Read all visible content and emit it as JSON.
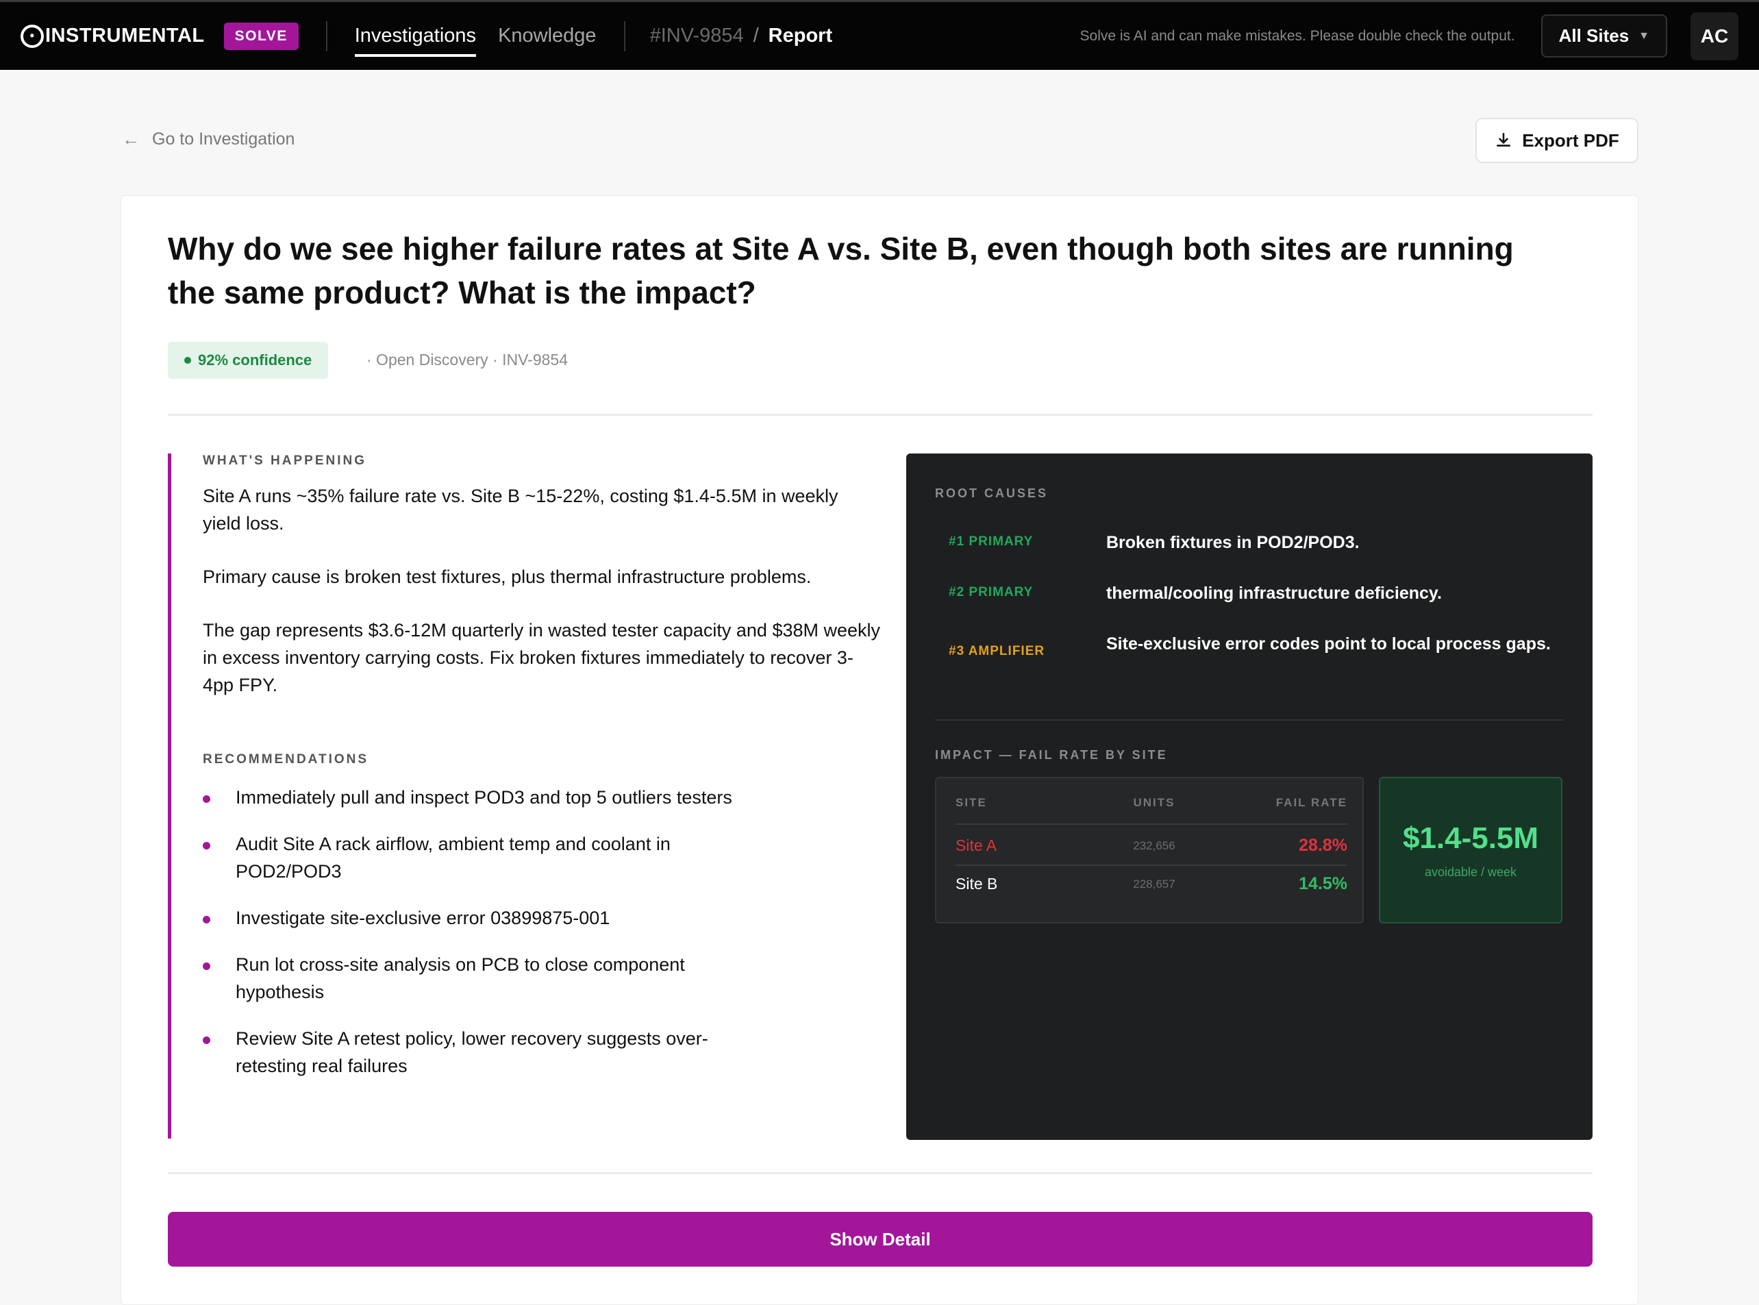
{
  "nav": {
    "logo_text": "INSTRUMENTAL",
    "logo_mark": "IN",
    "badge": "SOLVE",
    "links": [
      {
        "label": "Investigations",
        "active": true
      },
      {
        "label": "Knowledge",
        "active": false
      }
    ],
    "breadcrumb": {
      "id": "#INV-9854",
      "separator": "/",
      "page": "Report"
    },
    "disclaimer": "Solve is AI and can make mistakes. Please double check the output.",
    "site_select": {
      "value": "All Sites",
      "icon": "chevron-down-icon"
    },
    "avatar": "AC"
  },
  "subheader": {
    "back_label": "Go to Investigation",
    "back_icon": "arrow-left-icon",
    "export_label": "Export PDF",
    "export_icon": "download-icon"
  },
  "report": {
    "question": "Why do we see higher failure rates at Site A vs. Site B, even though both sites are running the same product? What is the impact?",
    "confidence": "92% confidence",
    "meta": "· Open Discovery · INV-9854",
    "whats_happening": {
      "label": "WHAT'S HAPPENING",
      "paragraphs": [
        "Site A runs ~35% failure rate vs. Site B ~15-22%, costing $1.4-5.5M in weekly yield loss.",
        "Primary cause is broken test fixtures, plus thermal infrastructure problems.",
        "The gap represents $3.6-12M quarterly in wasted tester capacity and $38M weekly in excess inventory carrying costs. Fix broken fixtures immediately to recover 3-4pp FPY."
      ]
    },
    "recommendations": {
      "label": "RECOMMENDATIONS",
      "items": [
        "Immediately pull and inspect POD3 and top 5 outliers testers",
        "Audit Site A rack airflow, ambient temp and coolant in POD2/POD3",
        "Investigate site-exclusive error 03899875-001",
        "Run lot cross-site analysis on PCB to close component hypothesis",
        "Review Site A retest policy, lower recovery suggests over-retesting real failures"
      ]
    },
    "root_causes": {
      "label": "ROOT CAUSES",
      "items": [
        {
          "tag": "#1 PRIMARY",
          "text": "Broken fixtures in POD2/POD3.",
          "color": "#1faa5a"
        },
        {
          "tag": "#2 PRIMARY",
          "text": "thermal/cooling infrastructure deficiency.",
          "color": "#1faa5a"
        },
        {
          "tag": "#3 AMPLIFIER",
          "text": "Site-exclusive error codes point to local process gaps.",
          "color": "#e3a21a"
        }
      ]
    },
    "impact": {
      "label": "IMPACT — FAIL RATE BY SITE",
      "columns": [
        "SITE",
        "UNITS",
        "FAIL RATE"
      ],
      "rows": [
        {
          "site": "Site A",
          "units": "232,656",
          "fail_rate": "28.8%",
          "site_color": "#e0323c",
          "rate_color": "#e0323c"
        },
        {
          "site": "Site B",
          "units": "228,657",
          "fail_rate": "14.5%",
          "site_color": "#ffffff",
          "rate_color": "#2fbf63"
        }
      ],
      "value": "$1.4-5.5M",
      "value_sub": "avoidable / week"
    },
    "detail_button": "Show Detail"
  },
  "colors": {
    "accent": "#a3169a",
    "success": "#1c8a3f",
    "danger": "#e0323c",
    "warning": "#e3a21a"
  }
}
